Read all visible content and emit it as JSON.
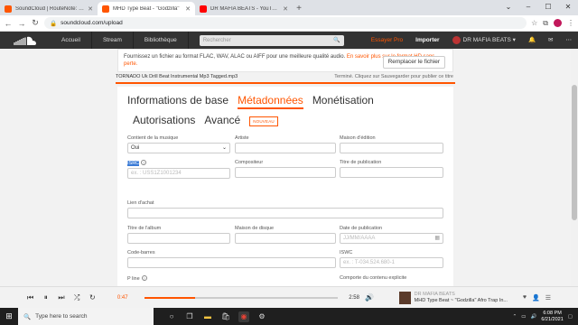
{
  "browser": {
    "tabs": [
      {
        "title": "SoundCloud | RouteNote: Sell Yo",
        "color": "#f50",
        "active": false
      },
      {
        "title": "MHD Type Beat - \"Godzilla\"",
        "color": "#f50",
        "active": true
      },
      {
        "title": "DR MAFIA BEATS - YouTube",
        "color": "#ff0000",
        "active": false
      }
    ],
    "new_tab": "+",
    "url": "soundcloud.com/upload"
  },
  "header": {
    "nav": [
      "Accueil",
      "Stream",
      "Bibliothèque"
    ],
    "search_placeholder": "Rechercher",
    "try_pro": "Essayer Pro",
    "upload": "Importer",
    "username": "DR MAFIA BEATS"
  },
  "notice": {
    "text": "Fournissez un fichier au format FLAC, WAV, ALAC ou AIFF pour une meilleure qualité audio.",
    "link": "En savoir plus sur le format HD sans perte.",
    "replace_button": "Remplacer le fichier"
  },
  "file": {
    "name": "TORNADO Uk Drill Beat Instrumental Mp3 Tagged.mp3",
    "status": "Terminé. Cliquez sur Sauvegarder pour publier ce titre"
  },
  "tabs": {
    "basic": "Informations de base",
    "metadata": "Métadonnées",
    "monetization": "Monétisation",
    "permissions": "Autorisations",
    "advanced": "Avancé",
    "new_badge": "NOUVEAU"
  },
  "form": {
    "contains_music_label": "Contient de la musique",
    "contains_music_value": "Oui",
    "artist_label": "Artiste",
    "publisher_label": "Maison d'édition",
    "isrc_label": "ISRC",
    "isrc_placeholder": "ex. : USS1Z1001234",
    "composer_label": "Compositeur",
    "release_title_label": "Titre de publication",
    "buy_link_label": "Lien d'achat",
    "album_title_label": "Titre de l'album",
    "record_label_label": "Maison de disque",
    "release_date_label": "Date de publication",
    "release_date_placeholder": "JJ/MM/AAAA",
    "barcode_label": "Code-barres",
    "iswc_label": "ISWC",
    "iswc_placeholder": "ex. : T-034.524.680-1",
    "p_line_label": "P line",
    "explicit_label": "Comporte du contenu explicite"
  },
  "player": {
    "current_time": "0:47",
    "duration": "2:58",
    "progress": 0.26,
    "artist": "DR MAFIA BEATS",
    "track": "MHD Type Beat ~ \"Godzilla\" Afro Trap In..."
  },
  "taskbar": {
    "search_placeholder": "Type here to search",
    "time": "6:08 PM",
    "date": "6/21/2021"
  }
}
